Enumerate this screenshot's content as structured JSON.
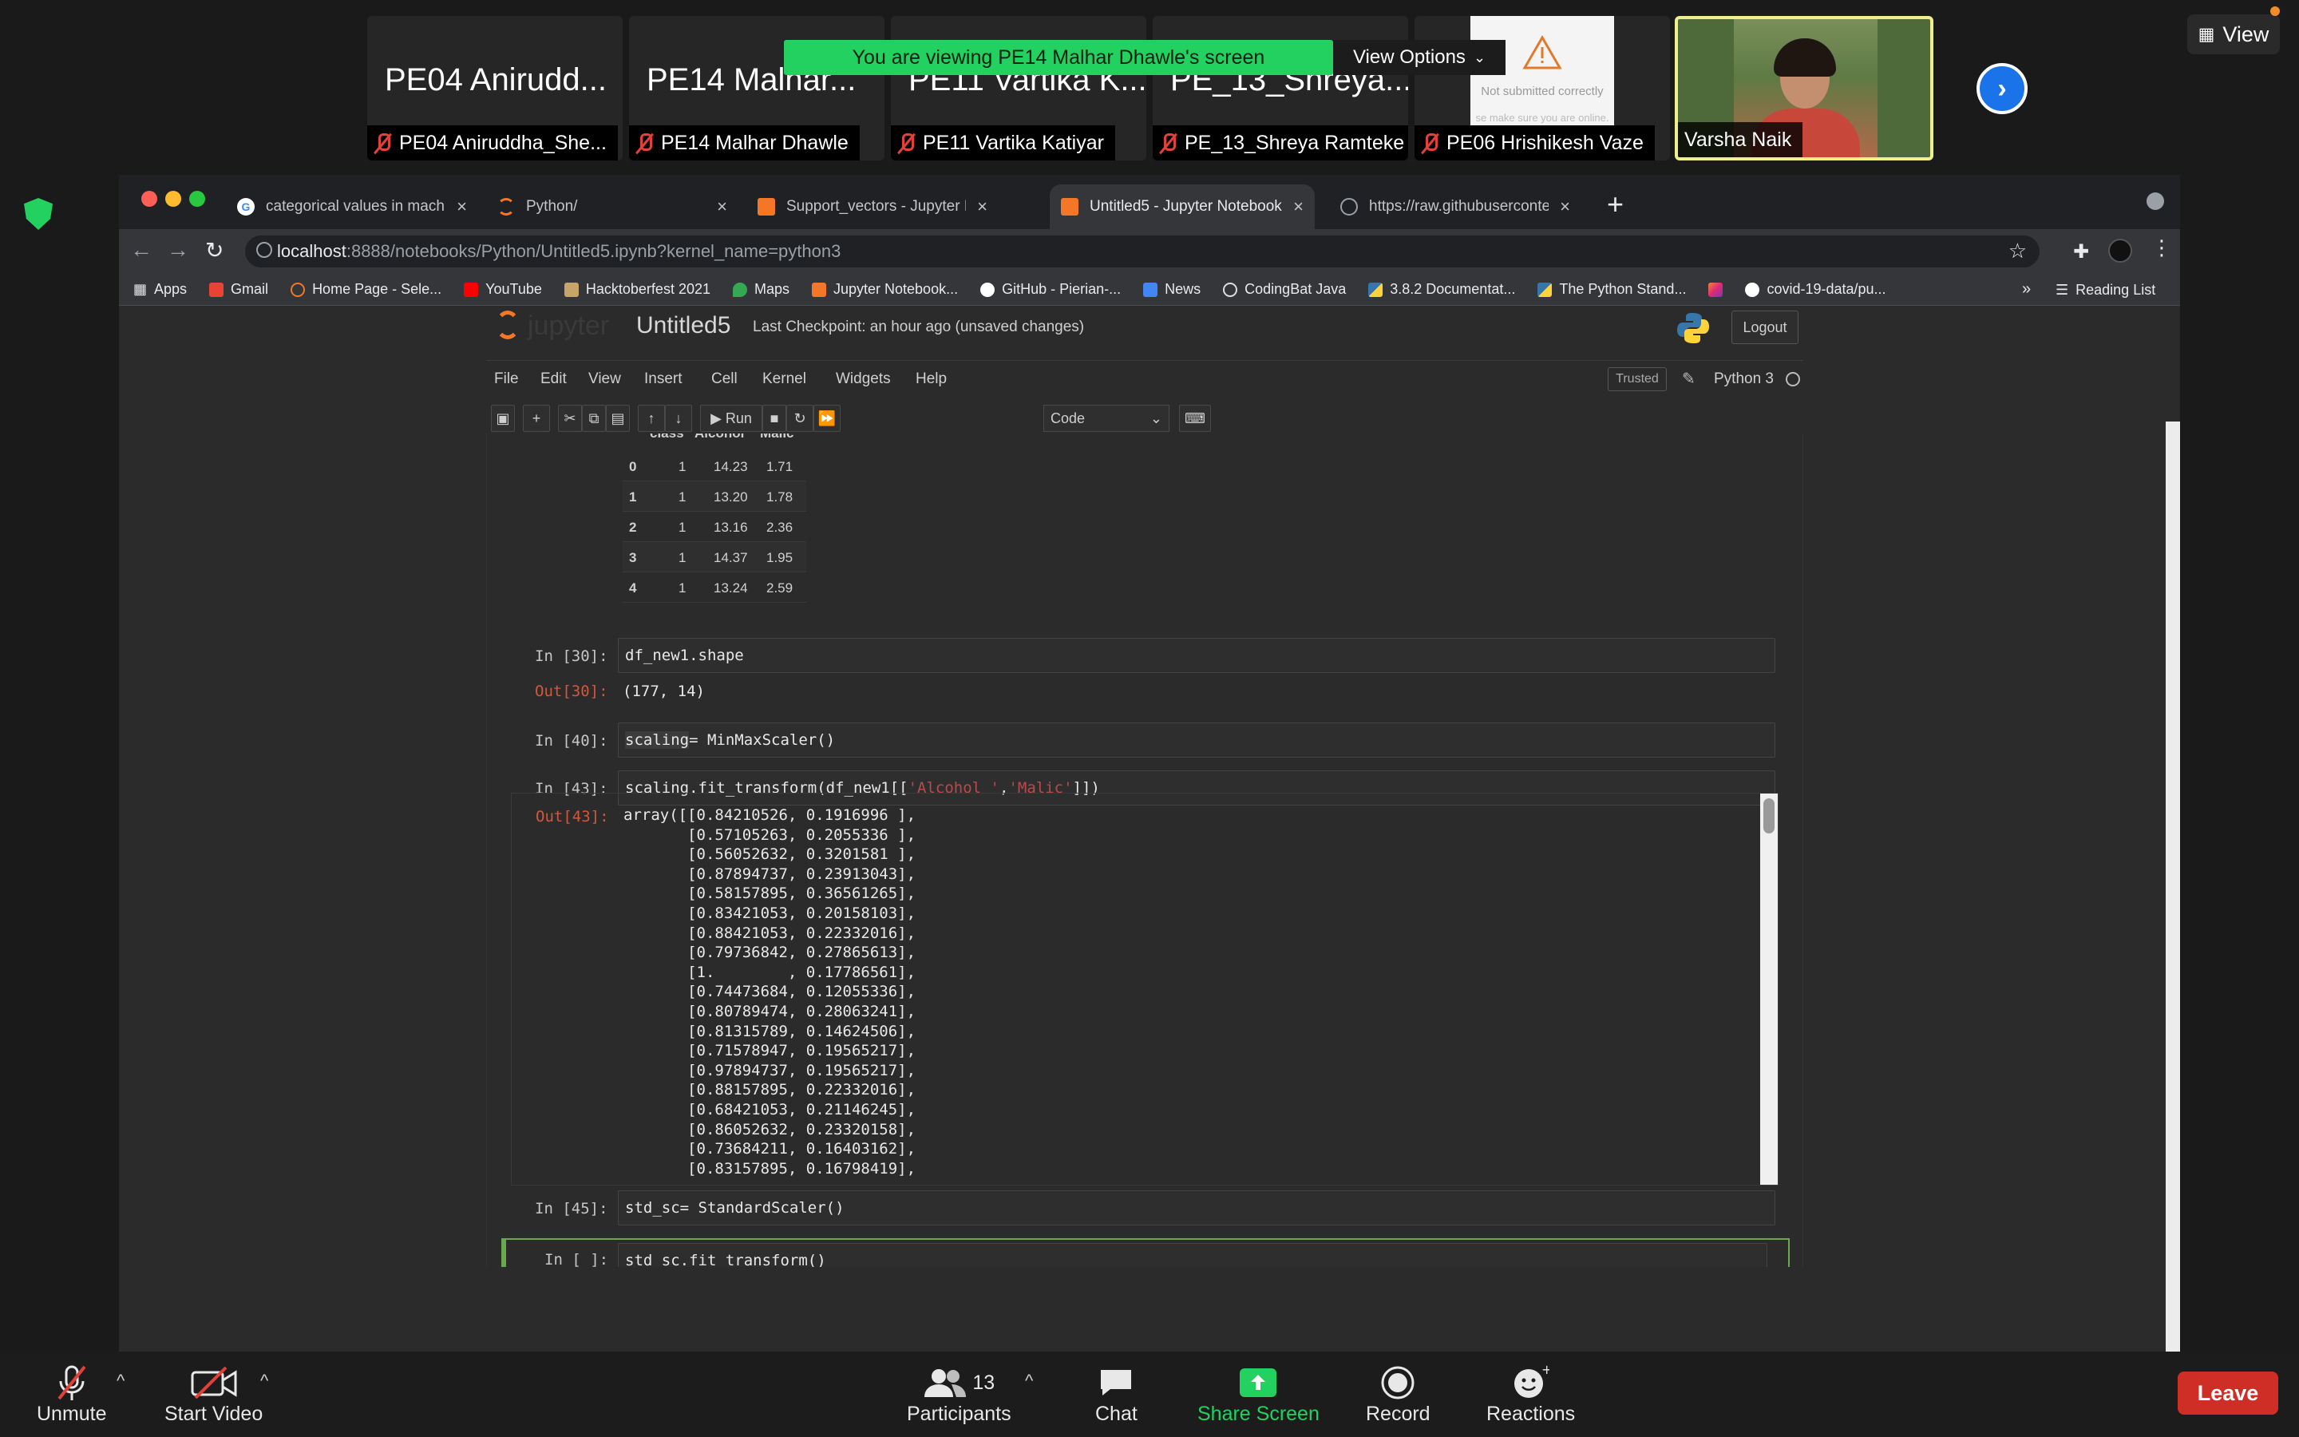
{
  "meeting": {
    "banner": "You are viewing PE14 Malhar Dhawle's screen",
    "view_options": "View Options",
    "view_button": "View",
    "participants": [
      {
        "tile_name": "PE04 Anirudd...",
        "label": "PE04 Aniruddha_She..."
      },
      {
        "tile_name": "PE14 Malhar...",
        "label": "PE14 Malhar Dhawle"
      },
      {
        "tile_name": "PE11 Vartika K...",
        "label": "PE11 Vartika Katiyar"
      },
      {
        "tile_name": "PE_13_Shreya...",
        "label": "PE_13_Shreya Ramteke"
      },
      {
        "tile_name": "",
        "label": "PE06 Hrishikesh Vaze",
        "thumb_text": "Not submitted correctly",
        "thumb_sub": "se make sure you are online."
      },
      {
        "tile_name": "",
        "label": "Varsha Naik"
      }
    ]
  },
  "browser": {
    "tabs": [
      {
        "title": "categorical values in machine l",
        "icon": "google-icon"
      },
      {
        "title": "Python/",
        "icon": "jupyter-icon"
      },
      {
        "title": "Support_vectors - Jupyter Not",
        "icon": "jupyter-icon"
      },
      {
        "title": "Untitled5 - Jupyter Notebook",
        "icon": "jupyter-icon",
        "active": true
      },
      {
        "title": "https://raw.githubusercontent.",
        "icon": "globe-icon"
      }
    ],
    "url_host": "localhost",
    "url_path": ":8888/notebooks/Python/Untitled5.ipynb?kernel_name=python3",
    "bookmarks": [
      "Apps",
      "Gmail",
      "Home Page - Sele...",
      "YouTube",
      "Hacktoberfest 2021",
      "Maps",
      "Jupyter Notebook...",
      "GitHub - Pierian-...",
      "News",
      "CodingBat Java",
      "3.8.2 Documentat...",
      "The Python Stand...",
      "",
      "covid-19-data/pu..."
    ],
    "reading_list": "Reading List",
    "more": "»"
  },
  "jupyter": {
    "logo": "jupyter",
    "notebook_name": "Untitled5",
    "checkpoint": "Last Checkpoint: an hour ago  (unsaved changes)",
    "logout": "Logout",
    "menu": [
      "File",
      "Edit",
      "View",
      "Insert",
      "Cell",
      "Kernel",
      "Widgets",
      "Help"
    ],
    "trusted": "Trusted",
    "kernel_name": "Python 3",
    "run_label": "Run",
    "cell_type": "Code"
  },
  "dataframe": {
    "columns": [
      "class",
      "Alcohol",
      "Malic"
    ],
    "rows": [
      [
        "0",
        "1",
        "14.23",
        "1.71"
      ],
      [
        "1",
        "1",
        "13.20",
        "1.78"
      ],
      [
        "2",
        "1",
        "13.16",
        "2.36"
      ],
      [
        "3",
        "1",
        "14.37",
        "1.95"
      ],
      [
        "4",
        "1",
        "13.24",
        "2.59"
      ]
    ]
  },
  "cells": {
    "c30_in_prompt": "In [30]:",
    "c30_code": "df_new1.shape",
    "c30_out_prompt": "Out[30]:",
    "c30_out": "(177, 14)",
    "c40_in_prompt": "In [40]:",
    "c40_code_a": "scaling",
    "c40_code_b": "= MinMaxScaler()",
    "c43_in_prompt": "In [43]:",
    "c43_code_a": "scaling.fit_transform(df_new1[[",
    "c43_code_s1": "'Alcohol '",
    "c43_code_c": ",",
    "c43_code_s2": "'Malic'",
    "c43_code_d": "]])",
    "c43_out_prompt": "Out[43]:",
    "c43_array": [
      "array([[0.84210526, 0.1916996 ],",
      "       [0.57105263, 0.2055336 ],",
      "       [0.56052632, 0.3201581 ],",
      "       [0.87894737, 0.23913043],",
      "       [0.58157895, 0.36561265],",
      "       [0.83421053, 0.20158103],",
      "       [0.88421053, 0.22332016],",
      "       [0.79736842, 0.27865613],",
      "       [1.        , 0.17786561],",
      "       [0.74473684, 0.12055336],",
      "       [0.80789474, 0.28063241],",
      "       [0.81315789, 0.14624506],",
      "       [0.71578947, 0.19565217],",
      "       [0.97894737, 0.19565217],",
      "       [0.88157895, 0.22332016],",
      "       [0.68421053, 0.21146245],",
      "       [0.86052632, 0.23320158],",
      "       [0.73684211, 0.16403162],",
      "       [0.83157895, 0.16798419],"
    ],
    "c45_in_prompt": "In [45]:",
    "c45_code": "std_sc= StandardScaler()",
    "cnew_in_prompt": "In [ ]:",
    "cnew_code": "std_sc.fit_transform()"
  },
  "zoom_bar": {
    "unmute": "Unmute",
    "start_video": "Start Video",
    "participants_count": "13",
    "participants": "Participants",
    "chat": "Chat",
    "share_screen": "Share Screen",
    "record": "Record",
    "reactions": "Reactions",
    "leave": "Leave"
  },
  "colors": {
    "banner_green": "#23d160",
    "leave_red": "#cf2e27",
    "jupyter_orange": "#f37726",
    "output_prompt": "#d3573c"
  }
}
